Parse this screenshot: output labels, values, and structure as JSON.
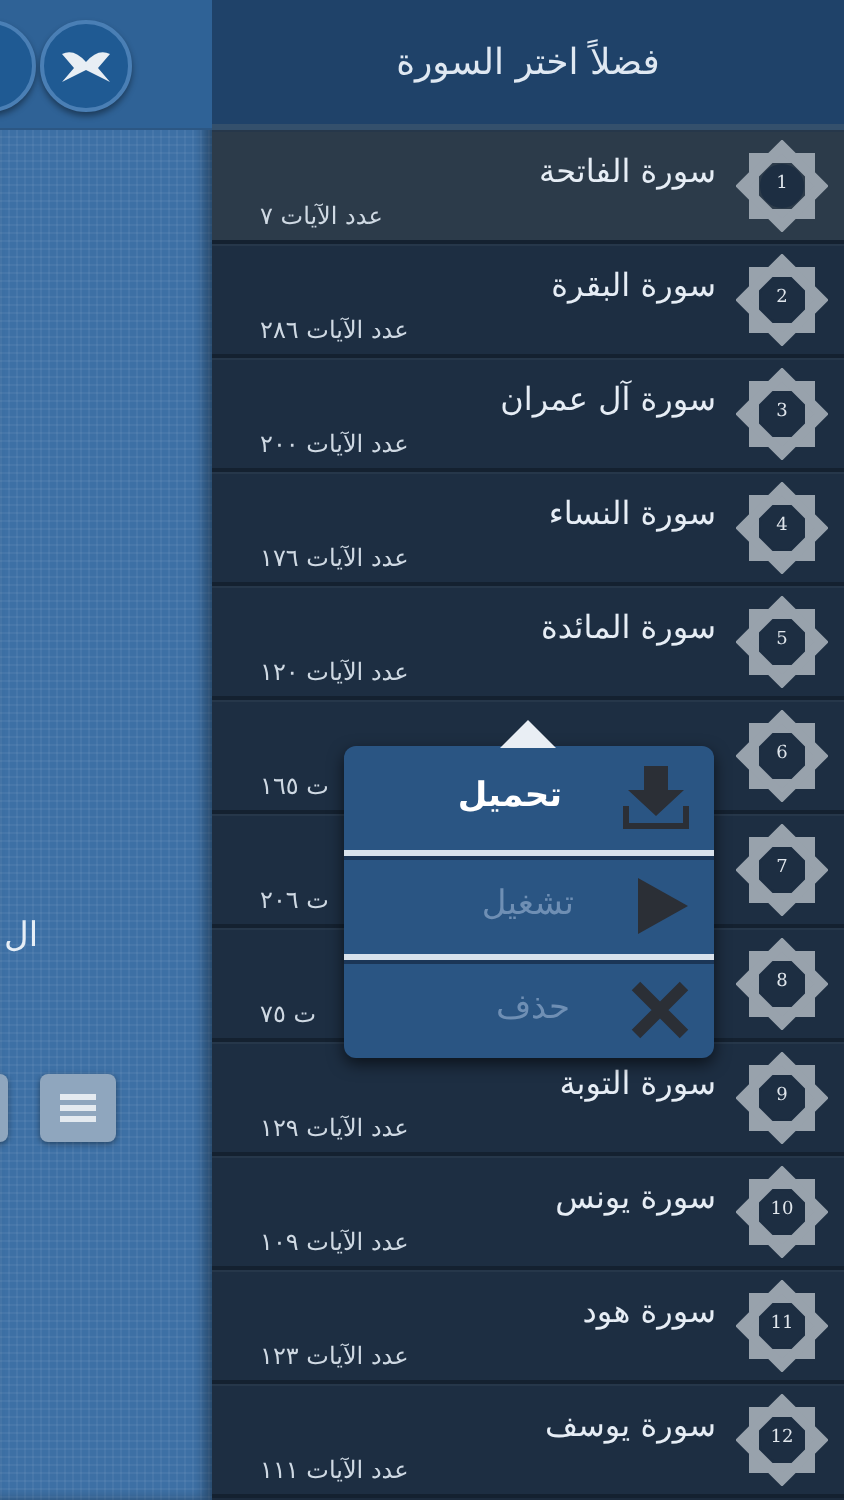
{
  "side_panel": {
    "partial_label": "ال"
  },
  "header": {
    "title": "فضلاً اختر السورة"
  },
  "surahs": [
    {
      "number": "1",
      "name": "سورة الفاتحة",
      "verse_count": "عدد الآيات ٧",
      "selected": true
    },
    {
      "number": "2",
      "name": "سورة البقرة",
      "verse_count": "عدد الآيات ٢٨٦",
      "selected": false
    },
    {
      "number": "3",
      "name": "سورة آل عمران",
      "verse_count": "عدد الآيات ٢٠٠",
      "selected": false
    },
    {
      "number": "4",
      "name": "سورة النساء",
      "verse_count": "عدد الآيات ١٧٦",
      "selected": false
    },
    {
      "number": "5",
      "name": "سورة المائدة",
      "verse_count": "عدد الآيات ١٢٠",
      "selected": false
    },
    {
      "number": "6",
      "verse_count": "ت ١٦٥",
      "selected": false
    },
    {
      "number": "7",
      "verse_count": "ت ٢٠٦",
      "selected": false
    },
    {
      "number": "8",
      "verse_count": "ت ٧٥",
      "selected": false
    },
    {
      "number": "9",
      "name": "سورة التوبة",
      "verse_count": "عدد الآيات ١٢٩",
      "selected": false
    },
    {
      "number": "10",
      "name": "سورة يونس",
      "verse_count": "عدد الآيات ١٠٩",
      "selected": false
    },
    {
      "number": "11",
      "name": "سورة هود",
      "verse_count": "عدد الآيات ١٢٣",
      "selected": false
    },
    {
      "number": "12",
      "name": "سورة يوسف",
      "verse_count": "عدد الآيات ١١١",
      "selected": false
    }
  ],
  "action_menu": {
    "items": [
      {
        "kind": "download",
        "label": "تحميل",
        "disabled": false
      },
      {
        "kind": "play",
        "label": "تشغيل",
        "disabled": true
      },
      {
        "kind": "delete",
        "label": "حذف",
        "disabled": true
      }
    ]
  }
}
